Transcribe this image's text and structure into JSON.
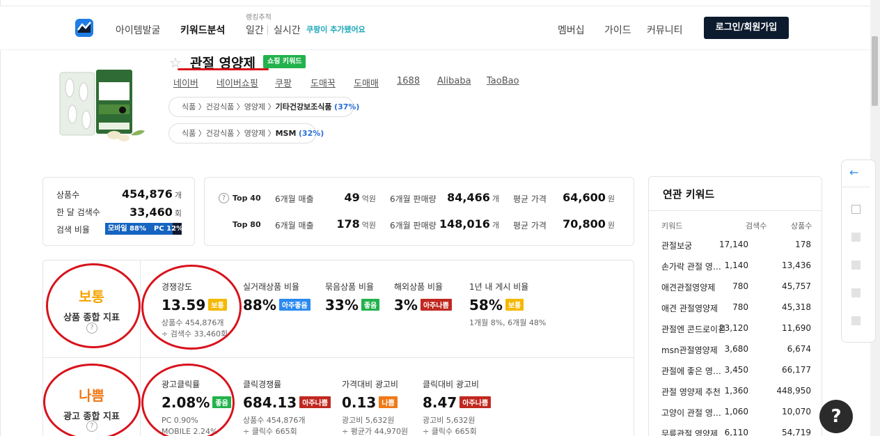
{
  "header": {
    "nav": [
      "아이템발굴",
      "키워드분석",
      "일간",
      "실시간"
    ],
    "rank_sup": "랭킹추적",
    "coupang_note": "쿠팡이 추가됐어요",
    "right_nav": [
      "멤버십",
      "가이드",
      "커뮤니티"
    ],
    "login": "로그인/회원가입"
  },
  "product": {
    "title": "관절 영양제",
    "badge": "쇼핑 키워드",
    "links": [
      "네이버",
      "네이버쇼핑",
      "쿠팡",
      "도매꾹",
      "도매매",
      "1688",
      "Alibaba",
      "TaoBao"
    ],
    "categories": [
      {
        "path": "식품 〉건강식품 〉영양제 〉",
        "leaf": "기타건강보조식품",
        "pct": "(37%)"
      },
      {
        "path": "식품 〉건강식품 〉영양제 〉",
        "leaf": "MSM",
        "pct": "(32%)"
      }
    ]
  },
  "summary": {
    "product_count_label": "상품수",
    "product_count": "454,876",
    "product_count_unit": "개",
    "monthly_search_label": "한 달 검색수",
    "monthly_search": "33,460",
    "monthly_search_unit": "회",
    "ratio_label": "검색 비율",
    "mobile_label": "모바일 88%",
    "pc_label": "PC 12%",
    "mobile_share": 88
  },
  "top": {
    "rows": [
      {
        "label": "Top 40",
        "sales_label": "6개월 매출",
        "sales": "49",
        "sales_unit": "억원",
        "vol_label": "6개월 판매량",
        "vol": "84,466",
        "vol_unit": "개",
        "price_label": "평균 가격",
        "price": "64,600",
        "price_unit": "원"
      },
      {
        "label": "Top 80",
        "sales_label": "6개월 매출",
        "sales": "178",
        "sales_unit": "억원",
        "vol_label": "6개월 판매량",
        "vol": "148,016",
        "vol_unit": "개",
        "price_label": "평균 가격",
        "price": "70,800",
        "price_unit": "원"
      }
    ]
  },
  "analysis": {
    "product": {
      "grade": "보통",
      "grade_color": "#f5a400",
      "desc": "상품 종합 지표",
      "metrics": [
        {
          "label": "경쟁강도",
          "value": "13.59",
          "tag": "보통",
          "tag_class": "t-yellow",
          "sub": [
            "상품수 454,876개",
            "÷ 검색수 33,460회"
          ]
        },
        {
          "label": "실거래상품 비율",
          "value": "88%",
          "tag": "아주좋음",
          "tag_class": "t-blue",
          "sub": []
        },
        {
          "label": "묶음상품 비율",
          "value": "33%",
          "tag": "좋음",
          "tag_class": "t-green",
          "sub": []
        },
        {
          "label": "해외상품 비율",
          "value": "3%",
          "tag": "아주나쁨",
          "tag_class": "t-red",
          "sub": []
        },
        {
          "label": "1년 내 게시 비율",
          "value": "58%",
          "tag": "보통",
          "tag_class": "t-yellow",
          "sub": [
            "1개월 8%, 6개월 48%"
          ]
        }
      ]
    },
    "ad": {
      "grade": "나쁨",
      "grade_color": "#f07a19",
      "desc": "광고 종합 지표",
      "metrics": [
        {
          "label": "광고클릭률",
          "value": "2.08%",
          "tag": "좋음",
          "tag_class": "t-green",
          "sub": [
            "PC 0.90%",
            "MOBILE 2.24%"
          ]
        },
        {
          "label": "클릭경쟁률",
          "value": "684.13",
          "tag": "아주나쁨",
          "tag_class": "t-red",
          "sub": [
            "상품수 454,876개",
            "÷ 클릭수 665회"
          ]
        },
        {
          "label": "가격대비 광고비",
          "value": "0.13",
          "tag": "나쁨",
          "tag_class": "t-orange",
          "sub": [
            "광고비 5,632원",
            "÷ 평균가 44,970원"
          ]
        },
        {
          "label": "클릭대비 광고비",
          "value": "8.47",
          "tag": "아주나쁨",
          "tag_class": "t-red",
          "sub": [
            "광고비 5,632원",
            "÷ 클릭수 665회"
          ]
        }
      ]
    }
  },
  "related": {
    "title": "연관 키워드",
    "headers": [
      "키워드",
      "검색수",
      "상품수"
    ],
    "rows": [
      {
        "kw": "관절보궁",
        "search": "17,140",
        "products": "178"
      },
      {
        "kw": "손가락 관절 영양제",
        "search": "1,140",
        "products": "13,436"
      },
      {
        "kw": "애견관절영양제",
        "search": "780",
        "products": "45,757"
      },
      {
        "kw": "애견 관절영양제",
        "search": "780",
        "products": "45,318"
      },
      {
        "kw": "관절엔 콘드로이친",
        "search": "23,120",
        "products": "11,690"
      },
      {
        "kw": "msn관절영양제",
        "search": "3,680",
        "products": "6,674"
      },
      {
        "kw": "관절에 좋은 영양제",
        "search": "3,450",
        "products": "66,177"
      },
      {
        "kw": "관절 영양제 추천",
        "search": "1,360",
        "products": "448,950"
      },
      {
        "kw": "고양이 관절 영양제",
        "search": "1,060",
        "products": "10,070"
      },
      {
        "kw": "무릎관절 영양제",
        "search": "6,110",
        "products": "54,719"
      }
    ]
  },
  "icons": {
    "logo": "chart-logo-icon",
    "help": "?",
    "back": "←",
    "star": "☆",
    "question": "?"
  }
}
